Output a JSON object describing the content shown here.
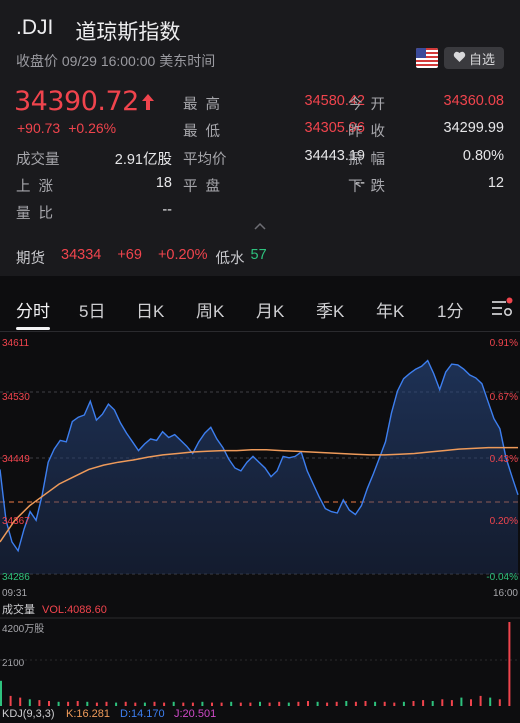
{
  "header": {
    "code": ".DJI",
    "name": "道琼斯指数",
    "status": "收盘价 09/29 16:00:00 美东时间",
    "watch_label": "自选"
  },
  "quote": {
    "price": "34390.72",
    "change": "+90.73",
    "change_pct": "+0.26%"
  },
  "stats": {
    "high_label": "最 高",
    "high": "34580.42",
    "open_label": "今 开",
    "open": "34360.08",
    "low_label": "最 低",
    "low": "34305.96",
    "prev_label": "昨 收",
    "prev": "34299.99",
    "volume_label": "成交量",
    "volume": "2.91亿股",
    "avg_label": "平均价",
    "avg": "34443.19",
    "amp_label": "振 幅",
    "amp": "0.80%",
    "up_label": "上 涨",
    "up": "18",
    "flat_label": "平 盘",
    "flat": "--",
    "down_label": "下 跌",
    "down": "12",
    "ratio_label": "量 比",
    "ratio": "--"
  },
  "futures": {
    "label": "期货",
    "price": "34334",
    "change": "+69",
    "pct": "+0.20%",
    "discount_label": "低水",
    "discount": "57"
  },
  "tabs": [
    "分时",
    "5日",
    "日K",
    "周K",
    "月K",
    "季K",
    "年K",
    "1分"
  ],
  "colors": {
    "up": "#f0444d",
    "down": "#2ec27e",
    "price_line": "#3d7ff0",
    "avg_line": "#ee9a5a",
    "background": "#0d0d0f"
  },
  "chart_data": {
    "type": "line",
    "ylim": [
      34286,
      34611
    ],
    "y_ticks_left": [
      "34611",
      "34530",
      "34449",
      "34367",
      "34286"
    ],
    "y_ticks_right": [
      "0.91%",
      "0.67%",
      "0.43%",
      "0.20%",
      "-0.04%"
    ],
    "x_ticks": [
      "09:31",
      "16:00"
    ],
    "prev_close": 34299.99,
    "series": [
      {
        "name": "price",
        "values": [
          34430,
          34360,
          34330,
          34318,
          34348,
          34372,
          34360,
          34395,
          34440,
          34458,
          34470,
          34468,
          34496,
          34502,
          34505,
          34524,
          34498,
          34506,
          34520,
          34512,
          34494,
          34480,
          34468,
          34456,
          34465,
          34472,
          34470,
          34482,
          34474,
          34478,
          34470,
          34462,
          34452,
          34468,
          34480,
          34488,
          34472,
          34460,
          34444,
          34432,
          34428,
          34440,
          34448,
          34440,
          34432,
          34420,
          34428,
          34448,
          34446,
          34448,
          34454,
          34428,
          34410,
          34392,
          34376,
          34372,
          34370,
          34388,
          34374,
          34368,
          34380,
          34404,
          34424,
          34446,
          34468,
          34508,
          34538,
          34555,
          34562,
          34568,
          34572,
          34580,
          34562,
          34540,
          34564,
          34575,
          34574,
          34568,
          34560,
          34556,
          34548,
          34524,
          34500,
          34486,
          34446,
          34420,
          34395
        ]
      },
      {
        "name": "average",
        "values": [
          34330,
          34360,
          34380,
          34395,
          34410,
          34420,
          34430,
          34436,
          34440,
          34443,
          34447,
          34450,
          34452,
          34454,
          34455,
          34456,
          34456,
          34457,
          34457,
          34456,
          34455,
          34454,
          34453,
          34452,
          34451,
          34450,
          34450,
          34451,
          34452,
          34454,
          34456,
          34458,
          34459,
          34460,
          34460,
          34460
        ]
      }
    ]
  },
  "volume_panel": {
    "label": "成交量",
    "vol": "VOL:4088.60",
    "max_label": "4200万股",
    "mid_label": "2100",
    "bars": [
      0.3,
      0.12,
      0.1,
      0.08,
      0.07,
      0.06,
      0.05,
      0.05,
      0.06,
      0.05,
      0.04,
      0.05,
      0.04,
      0.05,
      0.04,
      0.04,
      0.05,
      0.04,
      0.05,
      0.04,
      0.04,
      0.05,
      0.04,
      0.04,
      0.05,
      0.04,
      0.04,
      0.05,
      0.04,
      0.05,
      0.04,
      0.05,
      0.06,
      0.05,
      0.04,
      0.05,
      0.06,
      0.05,
      0.06,
      0.05,
      0.05,
      0.04,
      0.05,
      0.06,
      0.07,
      0.06,
      0.08,
      0.07,
      0.1,
      0.08,
      0.12,
      0.1,
      0.08,
      1.0
    ]
  },
  "kdj": {
    "label": "KDJ(9,3,3)",
    "k": "K:16.281",
    "d": "D:14.170",
    "j": "J:20.501"
  }
}
